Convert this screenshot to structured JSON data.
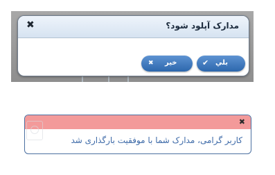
{
  "dialog": {
    "title": "مدارک آپلود شود؟",
    "close_glyph": "✖",
    "buttons": {
      "yes": {
        "label": "بلي",
        "icon": "check-icon",
        "glyph": "✔"
      },
      "no": {
        "label": "خير",
        "icon": "close-icon",
        "glyph": "✖"
      }
    }
  },
  "toast": {
    "message": "کاربر گرامی، مدارک شما با موفقیت بارگذاری شد",
    "close_glyph": "✖",
    "header_color": "#f39a9a",
    "text_color": "#3d6aa8"
  },
  "colors": {
    "button_primary": "#2d67ad",
    "dialog_header": "#d6e3f1",
    "backdrop": "#9a9a9a"
  }
}
